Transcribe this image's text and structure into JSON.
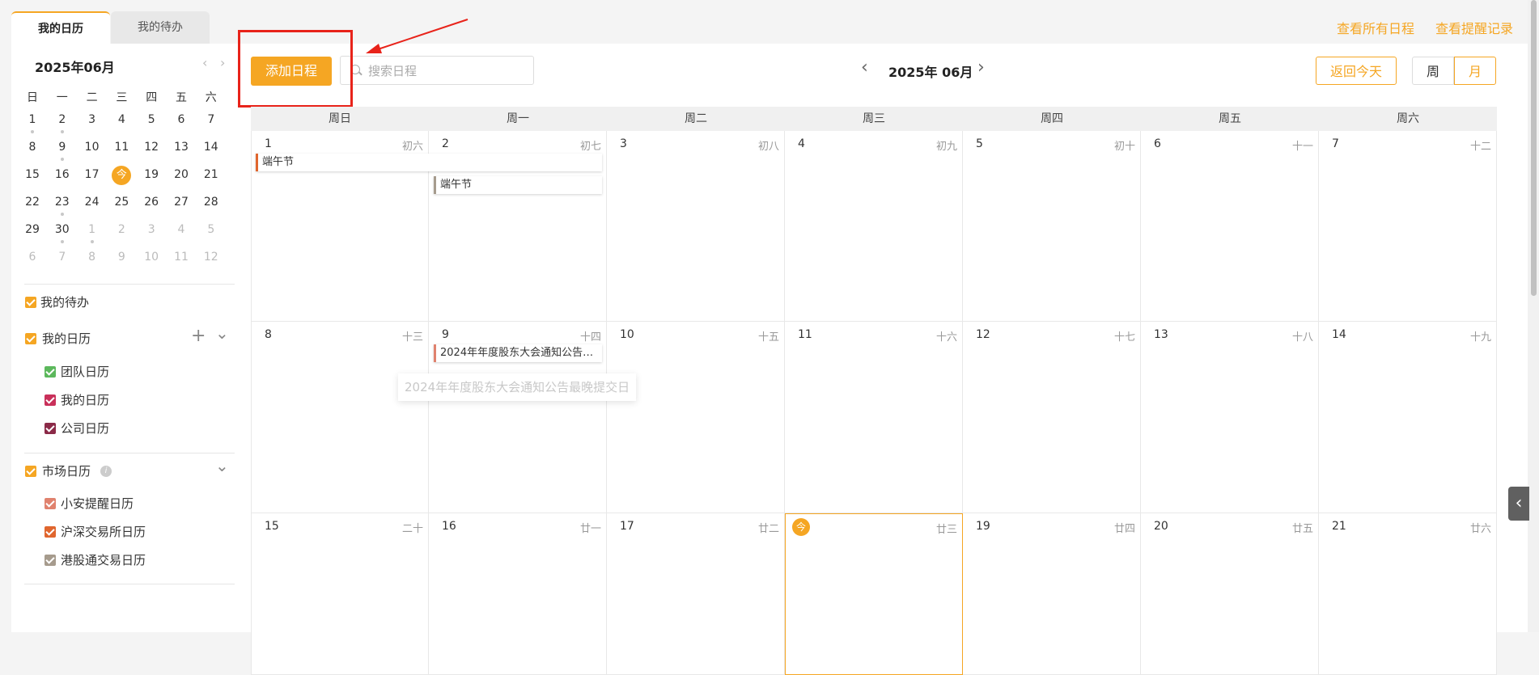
{
  "tabs": [
    {
      "label": "我的日历",
      "active": true
    },
    {
      "label": "我的待办",
      "active": false
    }
  ],
  "top_links": {
    "all_schedules": "查看所有日程",
    "reminders": "查看提醒记录"
  },
  "mini_calendar": {
    "title": "2025年06月",
    "prev_icon": "‹",
    "next_icon": "›",
    "weekdays": [
      "日",
      "一",
      "二",
      "三",
      "四",
      "五",
      "六"
    ],
    "weeks": [
      [
        {
          "d": "1",
          "dot": true
        },
        {
          "d": "2",
          "dot": true
        },
        {
          "d": "3"
        },
        {
          "d": "4"
        },
        {
          "d": "5"
        },
        {
          "d": "6"
        },
        {
          "d": "7"
        }
      ],
      [
        {
          "d": "8"
        },
        {
          "d": "9",
          "dot": true
        },
        {
          "d": "10"
        },
        {
          "d": "11"
        },
        {
          "d": "12"
        },
        {
          "d": "13"
        },
        {
          "d": "14"
        }
      ],
      [
        {
          "d": "15"
        },
        {
          "d": "16"
        },
        {
          "d": "17"
        },
        {
          "d": "今",
          "today": true
        },
        {
          "d": "19"
        },
        {
          "d": "20"
        },
        {
          "d": "21"
        }
      ],
      [
        {
          "d": "22"
        },
        {
          "d": "23",
          "dot": true
        },
        {
          "d": "24"
        },
        {
          "d": "25"
        },
        {
          "d": "26"
        },
        {
          "d": "27"
        },
        {
          "d": "28"
        }
      ],
      [
        {
          "d": "29"
        },
        {
          "d": "30",
          "dot": true
        },
        {
          "d": "1",
          "other": true,
          "dot": true
        },
        {
          "d": "2",
          "other": true
        },
        {
          "d": "3",
          "other": true
        },
        {
          "d": "4",
          "other": true
        },
        {
          "d": "5",
          "other": true
        }
      ],
      [
        {
          "d": "6",
          "other": true
        },
        {
          "d": "7",
          "other": true
        },
        {
          "d": "8",
          "other": true
        },
        {
          "d": "9",
          "other": true
        },
        {
          "d": "10",
          "other": true
        },
        {
          "d": "11",
          "other": true
        },
        {
          "d": "12",
          "other": true
        }
      ]
    ]
  },
  "sidebar": {
    "my_todo": {
      "label": "我的待办",
      "color": "#f5a623"
    },
    "my_calendars": {
      "label": "我的日历",
      "color": "#f5a623",
      "add_icon": "+",
      "collapse_icon": "⌄",
      "items": [
        {
          "label": "团队日历",
          "color": "#5cb85c"
        },
        {
          "label": "我的日历",
          "color": "#c9305a"
        },
        {
          "label": "公司日历",
          "color": "#8b2a48"
        }
      ]
    },
    "market_calendars": {
      "label": "市场日历",
      "color": "#f5a623",
      "info_icon": "i",
      "collapse_icon": "⌄",
      "items": [
        {
          "label": "小安提醒日历",
          "color": "#e0826e"
        },
        {
          "label": "沪深交易所日历",
          "color": "#e0662e"
        },
        {
          "label": "港股通交易日历",
          "color": "#a69b8d"
        }
      ]
    }
  },
  "toolbar": {
    "add_label": "添加日程",
    "search_placeholder": "搜索日程",
    "month_label": "2025年 06月",
    "prev_icon": "‹",
    "next_icon": "›",
    "today_label": "返回今天",
    "week_label": "周",
    "month_view_label": "月"
  },
  "calendar": {
    "weekdays": [
      "周日",
      "周一",
      "周二",
      "周三",
      "周四",
      "周五",
      "周六"
    ],
    "weeks": [
      [
        {
          "d": "1",
          "l": "初六"
        },
        {
          "d": "2",
          "l": "初七"
        },
        {
          "d": "3",
          "l": "初八"
        },
        {
          "d": "4",
          "l": "初九"
        },
        {
          "d": "5",
          "l": "初十"
        },
        {
          "d": "6",
          "l": "十一"
        },
        {
          "d": "7",
          "l": "十二"
        }
      ],
      [
        {
          "d": "8",
          "l": "十三"
        },
        {
          "d": "9",
          "l": "十四"
        },
        {
          "d": "10",
          "l": "十五"
        },
        {
          "d": "11",
          "l": "十六"
        },
        {
          "d": "12",
          "l": "十七"
        },
        {
          "d": "13",
          "l": "十八"
        },
        {
          "d": "14",
          "l": "十九"
        }
      ],
      [
        {
          "d": "15",
          "l": "二十"
        },
        {
          "d": "16",
          "l": "廿一"
        },
        {
          "d": "17",
          "l": "廿二"
        },
        {
          "d": "今",
          "l": "廿三",
          "today": true
        },
        {
          "d": "19",
          "l": "廿四"
        },
        {
          "d": "20",
          "l": "廿五"
        },
        {
          "d": "21",
          "l": "廿六"
        }
      ]
    ],
    "events": [
      {
        "title": "端午节",
        "week": 0,
        "start_col": 0,
        "span": 2,
        "row": 0,
        "color": "#e0662e"
      },
      {
        "title": "端午节",
        "week": 0,
        "start_col": 1,
        "span": 1,
        "row": 1,
        "color": "#a69b8d"
      },
      {
        "title": "2024年年度股东大会通知公告最晚提交日",
        "week": 1,
        "start_col": 1,
        "span": 1,
        "row": 0,
        "color": "#e0826e"
      }
    ],
    "tooltip": "2024年年度股东大会通知公告最晚提交日"
  },
  "side_toggle_icon": "‹"
}
